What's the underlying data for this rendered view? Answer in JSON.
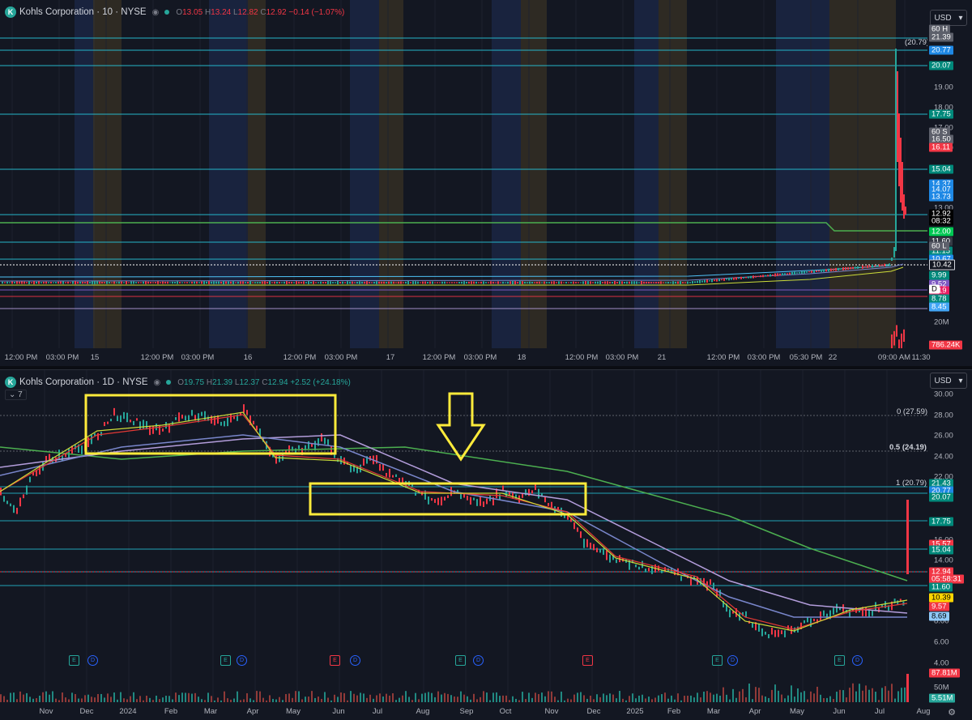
{
  "top_pane": {
    "logo": "K",
    "symbol": "Kohls Corporation · 10 · NYSE",
    "open_label": "O",
    "open": "13.05",
    "high_label": "H",
    "high": "13.24",
    "low_label": "L",
    "low": "12.82",
    "close_label": "C",
    "close": "12.92",
    "change": "−0.14 (−1.07%)",
    "currency": "USD",
    "price_ticks": [
      "19.00",
      "18.00",
      "17.00",
      "16.00",
      "15.00",
      "14.00",
      "13.00",
      "11.00",
      "10.00",
      "9.00"
    ],
    "price_tags": [
      {
        "text": "60 H",
        "color": "#5d606b"
      },
      {
        "text": "21.39",
        "color": "#5d606b"
      },
      {
        "text": "20.77",
        "color": "#1e88e5"
      },
      {
        "text": "20.07",
        "color": "#00897b"
      },
      {
        "text": "17.75",
        "color": "#00897b"
      },
      {
        "text": "60 S",
        "color": "#5d606b"
      },
      {
        "text": "16.50",
        "color": "#5d606b"
      },
      {
        "text": "16.11",
        "color": "#f23645"
      },
      {
        "text": "15.04",
        "color": "#00897b"
      },
      {
        "text": "14.37",
        "color": "#1e88e5"
      },
      {
        "text": "14.07",
        "color": "#1e88e5"
      },
      {
        "text": "13.73",
        "color": "#1e88e5"
      },
      {
        "text": "12.92",
        "color": "#000000"
      },
      {
        "text": "08:32",
        "color": "#000000"
      },
      {
        "text": "12.00",
        "color": "#00c853"
      },
      {
        "text": "11.60",
        "color": "#363a45"
      },
      {
        "text": "11.15",
        "color": "#00897b"
      },
      {
        "text": "10.67",
        "color": "#1e88e5"
      },
      {
        "text": "10.42",
        "color": "#131722"
      },
      {
        "text": "9.99",
        "color": "#00897b"
      },
      {
        "text": "9.52",
        "color": "#7e57c2"
      },
      {
        "text": "9.19",
        "color": "#e91e63"
      },
      {
        "text": "8.78",
        "color": "#00897b"
      },
      {
        "text": "8.45",
        "color": "#42a5f5"
      },
      {
        "text": "D",
        "color": "#ffffff"
      },
      {
        "text": "60 L",
        "color": "#5d606b"
      }
    ],
    "high_annotation": "(20.79)",
    "volume_tick": "20M",
    "volume_tag": "786.24K",
    "time_labels": [
      "12:00 PM",
      "03:00 PM",
      "15",
      "12:00 PM",
      "03:00 PM",
      "16",
      "12:00 PM",
      "03:00 PM",
      "17",
      "12:00 PM",
      "03:00 PM",
      "18",
      "12:00 PM",
      "03:00 PM",
      "21",
      "12:00 PM",
      "03:00 PM",
      "05:30 PM",
      "22",
      "09:00 AM",
      "11:30"
    ]
  },
  "bottom_pane": {
    "logo": "K",
    "symbol": "Kohls Corporation · 1D · NYSE",
    "open_label": "O",
    "open": "19.75",
    "high_label": "H",
    "high": "21.39",
    "low_label": "L",
    "low": "12.37",
    "close_label": "C",
    "close": "12.94",
    "change": "+2.52 (+24.18%)",
    "indicators_count": "7",
    "currency": "USD",
    "price_ticks": [
      "30.00",
      "28.00",
      "26.00",
      "24.00",
      "22.00",
      "16.00",
      "14.00",
      "8.00",
      "6.00",
      "4.00"
    ],
    "price_tags": [
      {
        "text": "21.43",
        "color": "#00897b"
      },
      {
        "text": "20.77",
        "color": "#1e88e5"
      },
      {
        "text": "20.07",
        "color": "#00897b"
      },
      {
        "text": "17.75",
        "color": "#00897b"
      },
      {
        "text": "15.57",
        "color": "#f23645"
      },
      {
        "text": "15.04",
        "color": "#00897b"
      },
      {
        "text": "12.94",
        "color": "#f23645"
      },
      {
        "text": "05:58:31",
        "color": "#f23645"
      },
      {
        "text": "11.60",
        "color": "#00897b"
      },
      {
        "text": "10.39",
        "color": "#ffd600"
      },
      {
        "text": "9.57",
        "color": "#f23645"
      },
      {
        "text": "8.69",
        "color": "#90caf9"
      }
    ],
    "fib_levels": [
      "0 (27.59)",
      "0.5 (24.19)",
      "1 (20.79)"
    ],
    "volume_tags": [
      {
        "text": "87.81M",
        "color": "#f23645"
      },
      {
        "text": "5.51M",
        "color": "#26a69a"
      }
    ],
    "volume_tick": "50M",
    "month_labels": [
      "Nov",
      "Dec",
      "2024",
      "Feb",
      "Mar",
      "Apr",
      "May",
      "Jun",
      "Jul",
      "Aug",
      "Sep",
      "Oct",
      "Nov",
      "Dec",
      "2025",
      "Feb",
      "Mar",
      "Apr",
      "May",
      "Jun",
      "Jul",
      "Aug"
    ],
    "events": [
      {
        "type": "e",
        "label": "E"
      },
      {
        "type": "d",
        "label": "D"
      },
      {
        "type": "e",
        "label": "E"
      },
      {
        "type": "d",
        "label": "D"
      },
      {
        "type": "er",
        "label": "E"
      },
      {
        "type": "d",
        "label": "D"
      },
      {
        "type": "e",
        "label": "E"
      },
      {
        "type": "d",
        "label": "D"
      },
      {
        "type": "er",
        "label": "E"
      },
      {
        "type": "e",
        "label": "E"
      },
      {
        "type": "d",
        "label": "D"
      },
      {
        "type": "e",
        "label": "E"
      },
      {
        "type": "d",
        "label": "D"
      }
    ]
  },
  "colors": {
    "background": "#131722",
    "up": "#26a69a",
    "down": "#f23645",
    "highlight_box": "#ffeb3b",
    "ma_green": "#4caf50",
    "ma_purple": "#b39ddb",
    "ma_blue": "#7986cb",
    "ma_red": "#e53935",
    "ma_yellow": "#cddc39",
    "level_line": "#26c6da"
  }
}
